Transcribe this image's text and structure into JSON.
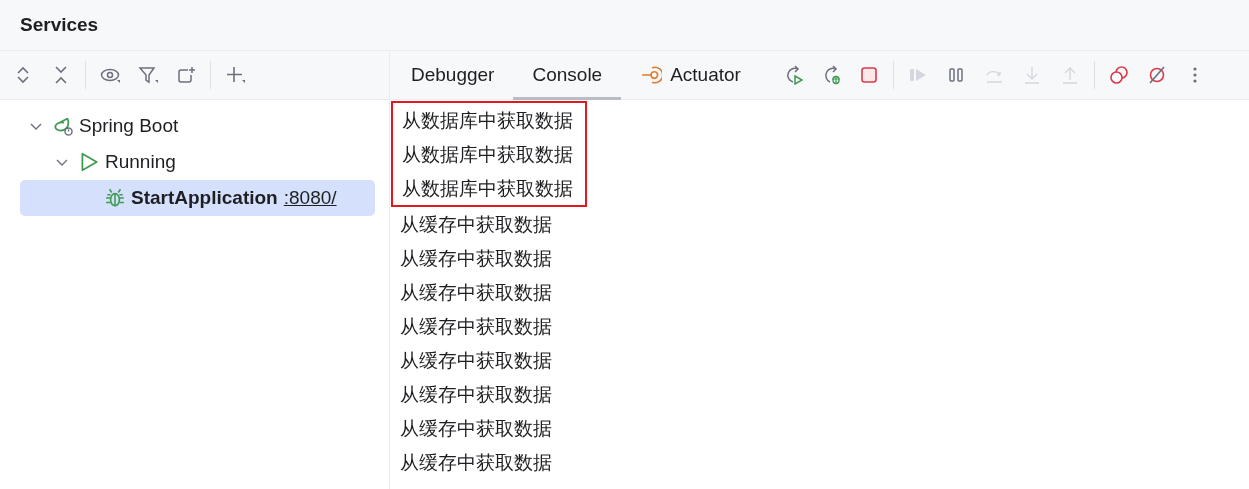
{
  "window": {
    "title": "Services"
  },
  "left_toolbar": [
    {
      "disabled": false
    },
    {
      "disabled": false
    },
    {
      "disabled": false
    },
    {
      "disabled": false
    },
    {
      "disabled": false
    },
    {
      "disabled": false
    }
  ],
  "tree": [
    {
      "label": "Spring Boot",
      "expanded": true,
      "selected": false,
      "children": [
        {
          "label": "Running",
          "expanded": true,
          "selected": false,
          "children": [
            {
              "label": "StartApplication",
              "link": ":8080/",
              "selected": true
            }
          ]
        }
      ]
    }
  ],
  "tabs": [
    {
      "label": "Debugger",
      "selected": false
    },
    {
      "label": "Console",
      "selected": true
    },
    {
      "label": "Actuator",
      "selected": false
    }
  ],
  "debug_toolbar": [
    {
      "disabled": false
    },
    {
      "disabled": false
    },
    {
      "disabled": false
    },
    {
      "disabled": true
    },
    {
      "disabled": false
    },
    {
      "disabled": true
    },
    {
      "disabled": true
    },
    {
      "disabled": true
    },
    {
      "disabled": false
    },
    {
      "disabled": false
    },
    {
      "disabled": false
    }
  ],
  "console": {
    "lines": [
      {
        "text": "从数据库中获取数据",
        "highlighted": true
      },
      {
        "text": "从数据库中获取数据",
        "highlighted": true
      },
      {
        "text": "从数据库中获取数据",
        "highlighted": true
      },
      {
        "text": "从缓存中获取数据",
        "highlighted": false
      },
      {
        "text": "从缓存中获取数据",
        "highlighted": false
      },
      {
        "text": "从缓存中获取数据",
        "highlighted": false
      },
      {
        "text": "从缓存中获取数据",
        "highlighted": false
      },
      {
        "text": "从缓存中获取数据",
        "highlighted": false
      },
      {
        "text": "从缓存中获取数据",
        "highlighted": false
      },
      {
        "text": "从缓存中获取数据",
        "highlighted": false
      },
      {
        "text": "从缓存中获取数据",
        "highlighted": false
      }
    ]
  }
}
